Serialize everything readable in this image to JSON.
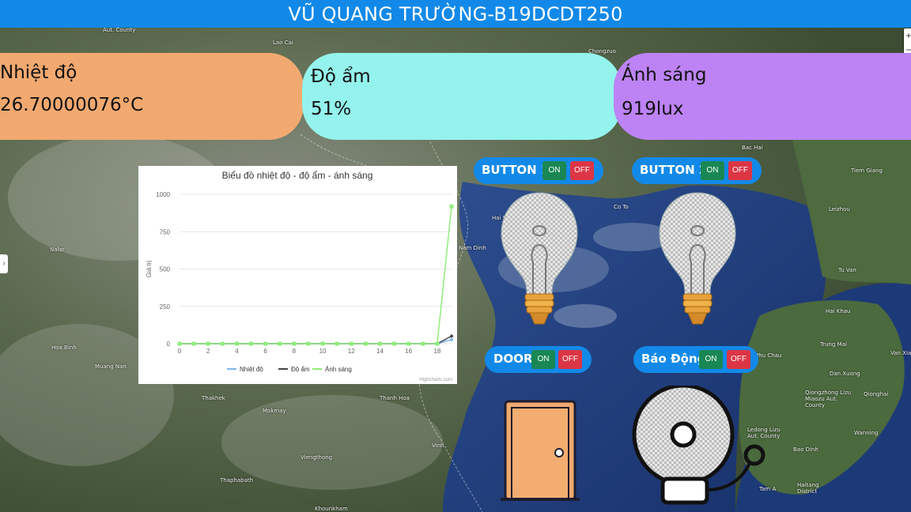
{
  "header": {
    "title": "VŨ QUANG TRƯỜNG-B19DCDT250"
  },
  "cards": {
    "temperature": {
      "label": "Nhiệt độ",
      "value": "26.70000076°C"
    },
    "humidity": {
      "label": "Độ ẩm",
      "value": "51%"
    },
    "light": {
      "label": "Ánh sáng",
      "value": "919lux"
    }
  },
  "controls": {
    "button1": {
      "label": "BUTTON 1",
      "on": "ON",
      "off": "OFF"
    },
    "button2": {
      "label": "BUTTON 2",
      "on": "ON",
      "off": "OFF"
    },
    "door": {
      "label": "DOOR",
      "on": "ON",
      "off": "OFF"
    },
    "alarm": {
      "label": "Báo Động",
      "on": "ON",
      "off": "OFF"
    }
  },
  "icons": {
    "bulb1": "light-bulb-icon",
    "bulb2": "light-bulb-icon",
    "door": "door-icon",
    "alarm": "alarm-bell-icon"
  },
  "map": {
    "labels": [
      "Aut. County",
      "Lao Cai",
      "Chongzuo",
      "Bac Hai",
      "Tiem Giang",
      "Leizhou",
      "Tu Van",
      "Hai Khau",
      "Trung Mai",
      "Van Xia",
      "Dan Xuong",
      "Qiongzhong Lizu Miaozu Aut. County",
      "Qionghai",
      "Wanning",
      "Ledong Lizu Aut. County",
      "Bao Dinh",
      "Tam A",
      "Haitang District",
      "Hai Phong",
      "Co To",
      "Thanh Hoa",
      "Vinh",
      "Nam Dinh",
      "Muang Nan",
      "Hoa Binh",
      "Thakhek",
      "Mokmay",
      "Viengthong",
      "Thaphabath",
      "Khounkham",
      "Nalar",
      "Phu Chau"
    ]
  },
  "colors": {
    "header": "#1289e8",
    "temp_card": "#f2a970",
    "hum_card": "#94f3ec",
    "light_card": "#bd83f5",
    "on": "#198754",
    "off": "#dc3545"
  },
  "chart_data": {
    "type": "line",
    "title": "Biểu đồ nhiệt độ - độ ẩm - ánh sáng",
    "xlabel": "",
    "ylabel": "Giá trị",
    "xlim": [
      0,
      19
    ],
    "ylim": [
      0,
      1000
    ],
    "x_ticks": [
      0,
      2,
      4,
      6,
      8,
      10,
      12,
      14,
      16,
      18
    ],
    "y_ticks": [
      0,
      250,
      500,
      750,
      1000
    ],
    "legend_position": "bottom",
    "credit": "Highcharts.com",
    "x": [
      0,
      1,
      2,
      3,
      4,
      5,
      6,
      7,
      8,
      9,
      10,
      11,
      12,
      13,
      14,
      15,
      16,
      17,
      18,
      19
    ],
    "series": [
      {
        "name": "Nhiệt độ",
        "color": "#7cb5ec",
        "values": [
          0,
          0,
          0,
          0,
          0,
          0,
          0,
          0,
          0,
          0,
          0,
          0,
          0,
          0,
          0,
          0,
          0,
          0,
          0,
          27
        ]
      },
      {
        "name": "Độ ẩm",
        "color": "#434348",
        "values": [
          0,
          0,
          0,
          0,
          0,
          0,
          0,
          0,
          0,
          0,
          0,
          0,
          0,
          0,
          0,
          0,
          0,
          0,
          0,
          51
        ]
      },
      {
        "name": "Ánh sáng",
        "color": "#90ed7d",
        "values": [
          0,
          0,
          0,
          0,
          0,
          0,
          0,
          0,
          0,
          0,
          0,
          0,
          0,
          0,
          0,
          0,
          0,
          0,
          0,
          919
        ]
      }
    ]
  }
}
